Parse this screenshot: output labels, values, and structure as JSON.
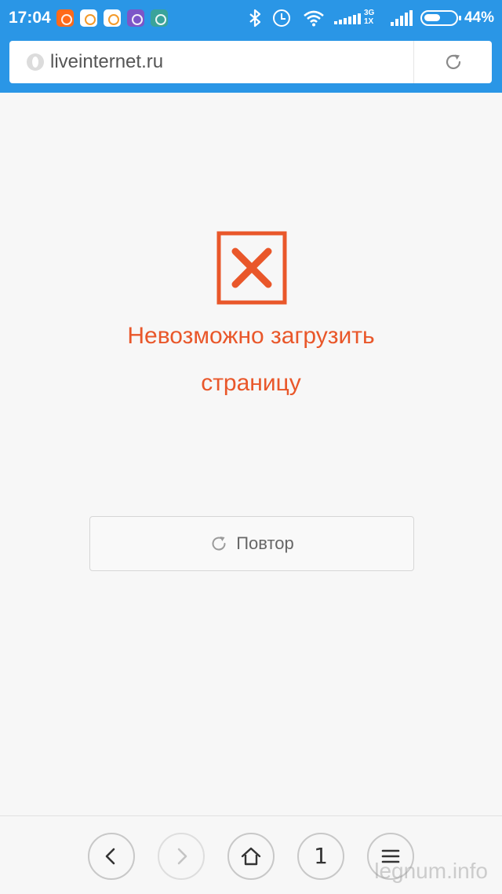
{
  "status_bar": {
    "time": "17:04",
    "notification_icons": [
      "app-notification-icon",
      "mail-icon",
      "mail-icon",
      "viber-icon",
      "camera-icon"
    ],
    "network_label_top": "3G",
    "network_label_bottom": "1X",
    "battery": "44%"
  },
  "address_bar": {
    "url": "liveinternet.ru"
  },
  "error": {
    "title": "Невозможно загрузить страницу",
    "accent_color": "#e9572a"
  },
  "retry": {
    "label": "Повтор"
  },
  "toolbar": {
    "tab_count": "1"
  },
  "watermark": "legnum.info",
  "colors": {
    "header": "#2a96e6",
    "background": "#f7f7f7"
  }
}
